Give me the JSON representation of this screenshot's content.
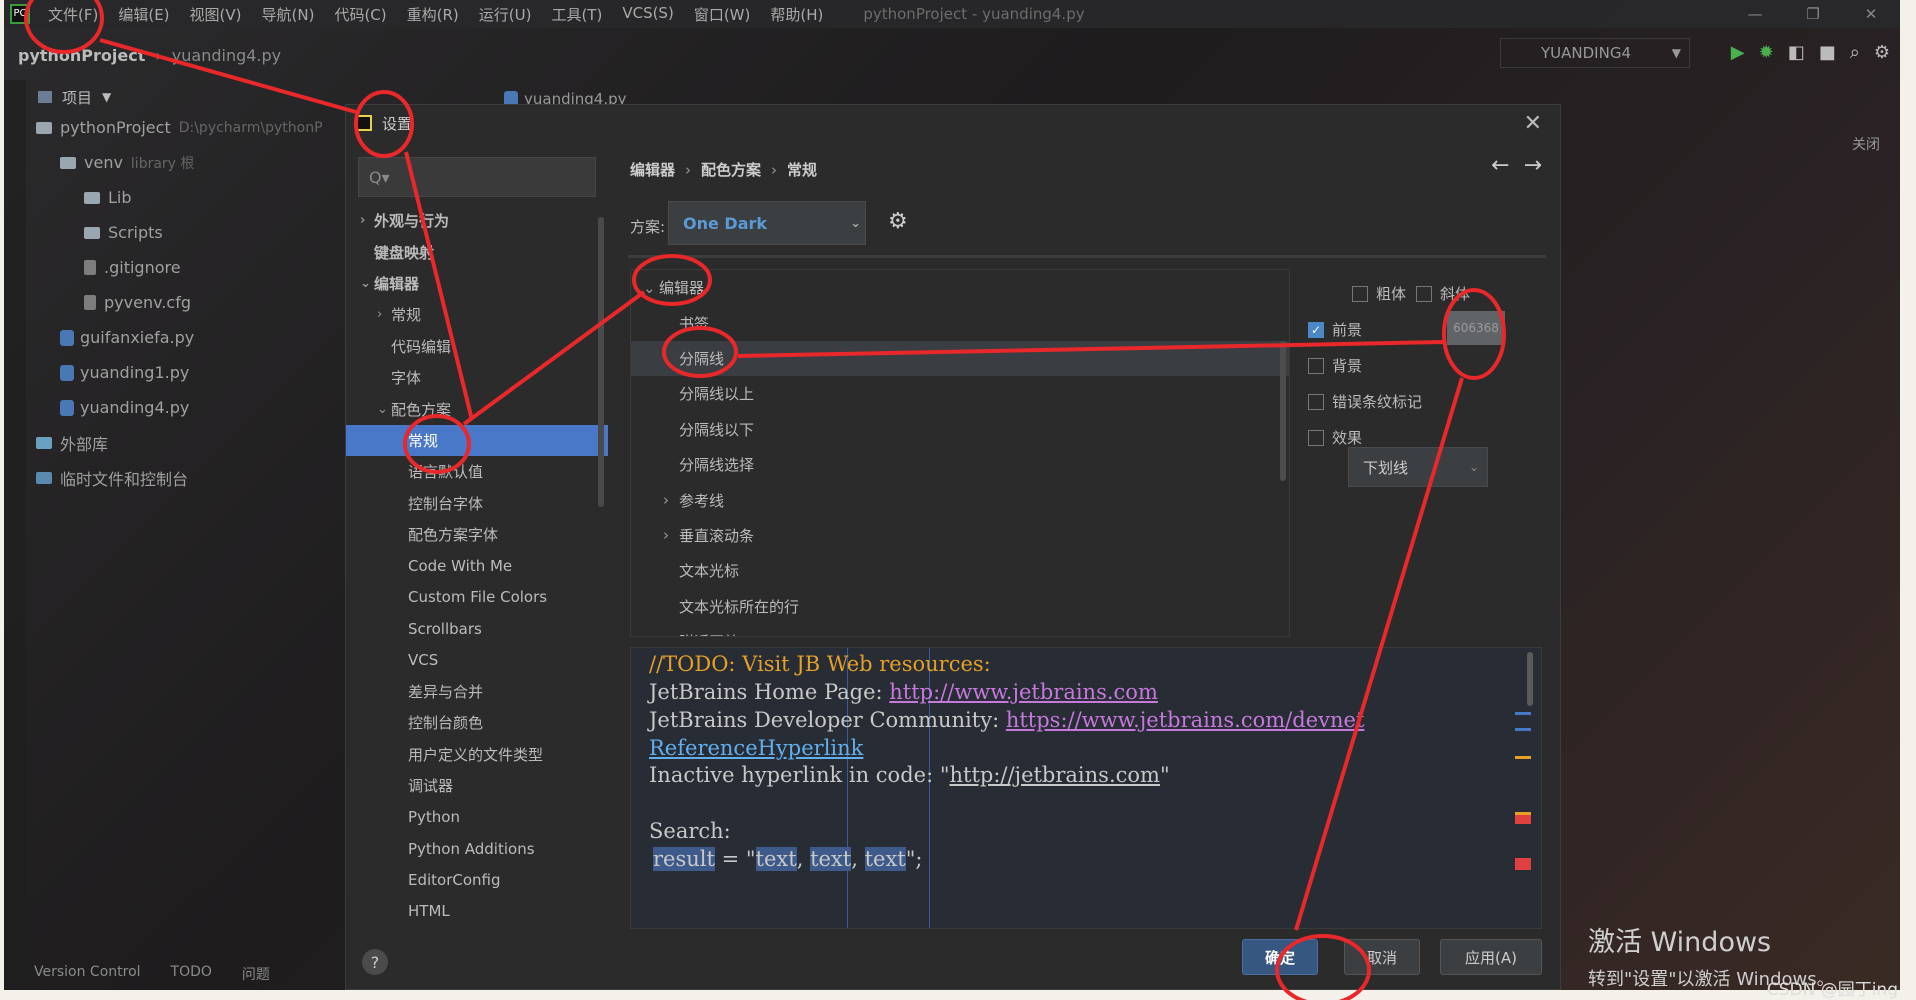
{
  "menu": {
    "items": [
      "文件(F)",
      "编辑(E)",
      "视图(V)",
      "导航(N)",
      "代码(C)",
      "重构(R)",
      "运行(U)",
      "工具(T)",
      "VCS(S)",
      "窗口(W)",
      "帮助(H)"
    ],
    "window_title": "pythonProject - yuanding4.py"
  },
  "navbar": {
    "project": "pythonProject",
    "file": "yuanding4.py",
    "run_config": "YUANDING4"
  },
  "project_panel": {
    "header": "项目",
    "tree": [
      {
        "label": "pythonProject",
        "hint": "D:\\pycharm\\pythonP",
        "kind": "folder",
        "indent": 0
      },
      {
        "label": "venv",
        "hint": "library 根",
        "kind": "folder",
        "indent": 1
      },
      {
        "label": "Lib",
        "kind": "folder",
        "indent": 2
      },
      {
        "label": "Scripts",
        "kind": "folder",
        "indent": 2
      },
      {
        "label": ".gitignore",
        "kind": "file",
        "indent": 2
      },
      {
        "label": "pyvenv.cfg",
        "kind": "file",
        "indent": 2
      },
      {
        "label": "guifanxiefa.py",
        "kind": "py",
        "indent": 1
      },
      {
        "label": "yuanding1.py",
        "kind": "py",
        "indent": 1
      },
      {
        "label": "yuanding4.py",
        "kind": "py",
        "indent": 1
      },
      {
        "label": "外部库",
        "kind": "lib",
        "indent": 0
      },
      {
        "label": "临时文件和控制台",
        "kind": "scratch",
        "indent": 0
      }
    ]
  },
  "editor_tab": "yuanding4.py",
  "statusbar": [
    "Version Control",
    "TODO",
    "问题"
  ],
  "right_edge_label": "关闭",
  "dialog": {
    "title": "设置",
    "search_placeholder": "Q▾",
    "nav": [
      {
        "label": "外观与行为",
        "arrow": "›",
        "level": 0,
        "bold": true
      },
      {
        "label": "键盘映射",
        "arrow": "",
        "level": 0,
        "bold": true
      },
      {
        "label": "编辑器",
        "arrow": "⌄",
        "level": 0,
        "bold": true
      },
      {
        "label": "常规",
        "arrow": "›",
        "level": 1
      },
      {
        "label": "代码编辑",
        "arrow": "",
        "level": 1
      },
      {
        "label": "字体",
        "arrow": "",
        "level": 1
      },
      {
        "label": "配色方案",
        "arrow": "⌄",
        "level": 1
      },
      {
        "label": "常规",
        "arrow": "",
        "level": 2,
        "selected": true
      },
      {
        "label": "语言默认值",
        "arrow": "",
        "level": 2
      },
      {
        "label": "控制台字体",
        "arrow": "",
        "level": 2
      },
      {
        "label": "配色方案字体",
        "arrow": "",
        "level": 2
      },
      {
        "label": "Code With Me",
        "arrow": "",
        "level": 2
      },
      {
        "label": "Custom File Colors",
        "arrow": "",
        "level": 2
      },
      {
        "label": "Scrollbars",
        "arrow": "",
        "level": 2
      },
      {
        "label": "VCS",
        "arrow": "",
        "level": 2
      },
      {
        "label": "差异与合并",
        "arrow": "",
        "level": 2
      },
      {
        "label": "控制台颜色",
        "arrow": "",
        "level": 2
      },
      {
        "label": "用户定义的文件类型",
        "arrow": "",
        "level": 2
      },
      {
        "label": "调试器",
        "arrow": "",
        "level": 2
      },
      {
        "label": "Python",
        "arrow": "",
        "level": 2
      },
      {
        "label": "Python Additions",
        "arrow": "",
        "level": 2
      },
      {
        "label": "EditorConfig",
        "arrow": "",
        "level": 2
      },
      {
        "label": "HTML",
        "arrow": "",
        "level": 2
      }
    ],
    "breadcrumb": [
      "编辑器",
      "配色方案",
      "常规"
    ],
    "scheme_label": "方案:",
    "scheme_value": "One Dark",
    "option_tree": [
      {
        "label": "编辑器",
        "arrow": "⌄",
        "child": false
      },
      {
        "label": "书签",
        "arrow": "",
        "child": true
      },
      {
        "label": "分隔线",
        "arrow": "",
        "child": true,
        "selected": true
      },
      {
        "label": "分隔线以上",
        "arrow": "",
        "child": true
      },
      {
        "label": "分隔线以下",
        "arrow": "",
        "child": true
      },
      {
        "label": "分隔线选择",
        "arrow": "",
        "child": true
      },
      {
        "label": "参考线",
        "arrow": "›",
        "child": true
      },
      {
        "label": "垂直滚动条",
        "arrow": "›",
        "child": true
      },
      {
        "label": "文本光标",
        "arrow": "",
        "child": true
      },
      {
        "label": "文本光标所在的行",
        "arrow": "",
        "child": true
      },
      {
        "label": "附近区效",
        "arrow": "",
        "child": true
      }
    ],
    "options": {
      "bold": "粗体",
      "italic": "斜体",
      "foreground": "前景",
      "foreground_color": "606368",
      "background": "背景",
      "error_stripe": "错误条纹标记",
      "effects": "效果",
      "effect_type": "下划线"
    },
    "preview": {
      "todo": "//TODO: Visit JB Web resources:",
      "home_label": "JetBrains Home Page: ",
      "home_link": "http://www.jetbrains.com",
      "dev_label": "JetBrains Developer Community: ",
      "dev_link": "https://www.jetbrains.com/devnet",
      "ref": "ReferenceHyperlink",
      "inactive_label": "Inactive hyperlink in code: \"",
      "inactive_link": "http://jetbrains.com",
      "inactive_end": "\"",
      "search": "Search:",
      "result": "result",
      "eq": " = \"",
      "t1": "text",
      "t2": "text",
      "t3": "text",
      "end": "\";"
    },
    "buttons": {
      "ok": "确定",
      "cancel": "取消",
      "apply": "应用(A)",
      "help": "?"
    }
  },
  "watermark": {
    "line1": "激活 Windows",
    "line2": "转到\"设置\"以激活 Windows。",
    "csdn": "CSDN @园丁ing"
  },
  "colors": {
    "selection": "#4a78c8",
    "annotation": "#e8282a",
    "link": "#c678dd",
    "todo": "#e5a027"
  }
}
